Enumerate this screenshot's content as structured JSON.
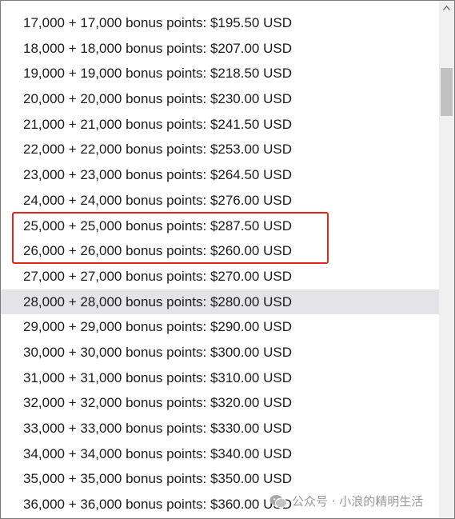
{
  "options": [
    "17,000 + 17,000 bonus points: $195.50 USD",
    "18,000 + 18,000 bonus points: $207.00 USD",
    "19,000 + 19,000 bonus points: $218.50 USD",
    "20,000 + 20,000 bonus points: $230.00 USD",
    "21,000 + 21,000 bonus points: $241.50 USD",
    "22,000 + 22,000 bonus points: $253.00 USD",
    "23,000 + 23,000 bonus points: $264.50 USD",
    "24,000 + 24,000 bonus points: $276.00 USD",
    "25,000 + 25,000 bonus points: $287.50 USD",
    "26,000 + 26,000 bonus points: $260.00 USD",
    "27,000 + 27,000 bonus points: $270.00 USD",
    "28,000 + 28,000 bonus points: $280.00 USD",
    "29,000 + 29,000 bonus points: $290.00 USD",
    "30,000 + 30,000 bonus points: $300.00 USD",
    "31,000 + 31,000 bonus points: $310.00 USD",
    "32,000 + 32,000 bonus points: $320.00 USD",
    "33,000 + 33,000 bonus points: $330.00 USD",
    "34,000 + 34,000 bonus points: $340.00 USD",
    "35,000 + 35,000 bonus points: $350.00 USD",
    "36,000 + 36,000 bonus points: $360.00 USD"
  ],
  "hovered_option": "28,000 + 28,000 bonus points: $280.00 USD",
  "highlighted_options": [
    "25,000 + 25,000 bonus points: $287.50 USD",
    "26,000 + 26,000 bonus points: $260.00 USD"
  ],
  "watermark": {
    "text": "公众号 · 小浪的精明生活",
    "icon": "wechat-logo-icon"
  },
  "colors": {
    "hover_bg": "#e4e3e8",
    "highlight_border": "#e0251f",
    "text": "#1a1a1a",
    "watermark": "#9a9a9a"
  }
}
